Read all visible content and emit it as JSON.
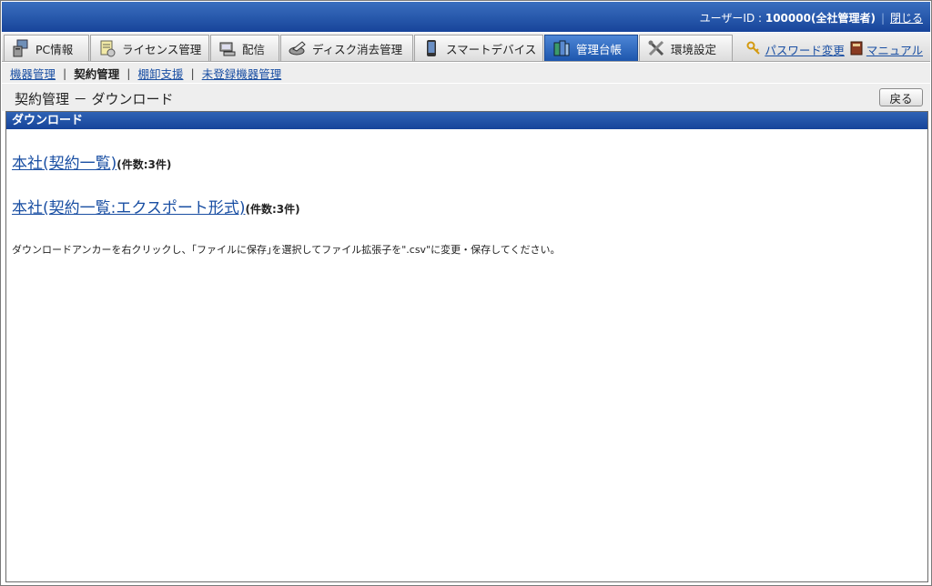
{
  "header": {
    "user_label": "ユーザーID : ",
    "user_value": "100000(全社管理者)",
    "logout": "閉じる"
  },
  "tabs": [
    {
      "label": "PC情報",
      "icon": "pc-icon"
    },
    {
      "label": "ライセンス管理",
      "icon": "license-icon"
    },
    {
      "label": "配信",
      "icon": "distribution-icon"
    },
    {
      "label": "ディスク消去管理",
      "icon": "disk-erase-icon"
    },
    {
      "label": "スマートデバイス",
      "icon": "smartphone-icon"
    },
    {
      "label": "管理台帳",
      "icon": "ledger-icon",
      "active": true
    },
    {
      "label": "環境設定",
      "icon": "tools-icon"
    }
  ],
  "right_links": {
    "password": "パスワード変更",
    "manual": "マニュアル"
  },
  "subnav": {
    "items": [
      "機器管理",
      "契約管理",
      "棚卸支援",
      "未登録機器管理"
    ],
    "current_index": 1
  },
  "page": {
    "title": "契約管理 － ダウンロード",
    "back_label": "戻る"
  },
  "panel": {
    "heading": "ダウンロード",
    "links": [
      {
        "label": "本社(契約一覧)",
        "count": "(件数:3件)"
      },
      {
        "label": "本社(契約一覧:エクスポート形式)",
        "count": "(件数:3件)"
      }
    ],
    "note": "ダウンロードアンカーを右クリックし、｢ファイルに保存｣を選択してファイル拡張子を\".csv\"に変更・保存してください。"
  },
  "colors": {
    "header_blue": "#17449a",
    "active_tab": "#1d56ad",
    "link": "#1a4fa3"
  }
}
